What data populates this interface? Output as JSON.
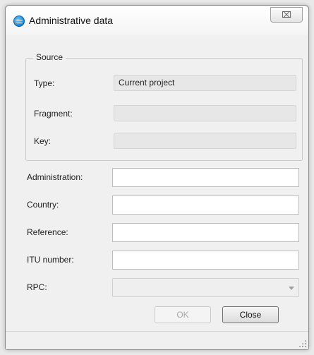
{
  "window": {
    "title": "Administrative data",
    "close_glyph": "⌧"
  },
  "source": {
    "group_title": "Source",
    "type_label": "Type:",
    "type_value": "Current project",
    "fragment_label": "Fragment:",
    "fragment_value": "",
    "key_label": "Key:",
    "key_value": ""
  },
  "form": {
    "administration_label": "Administration:",
    "administration_value": "",
    "country_label": "Country:",
    "country_value": "",
    "reference_label": "Reference:",
    "reference_value": "",
    "itu_label": "ITU number:",
    "itu_value": "",
    "rpc_label": "RPC:",
    "rpc_value": ""
  },
  "buttons": {
    "ok_label": "OK",
    "close_label": "Close"
  },
  "icons": {
    "app": "globe-icon",
    "close": "close-icon",
    "dropdown": "chevron-down-icon",
    "grip": "resize-grip-icon"
  }
}
